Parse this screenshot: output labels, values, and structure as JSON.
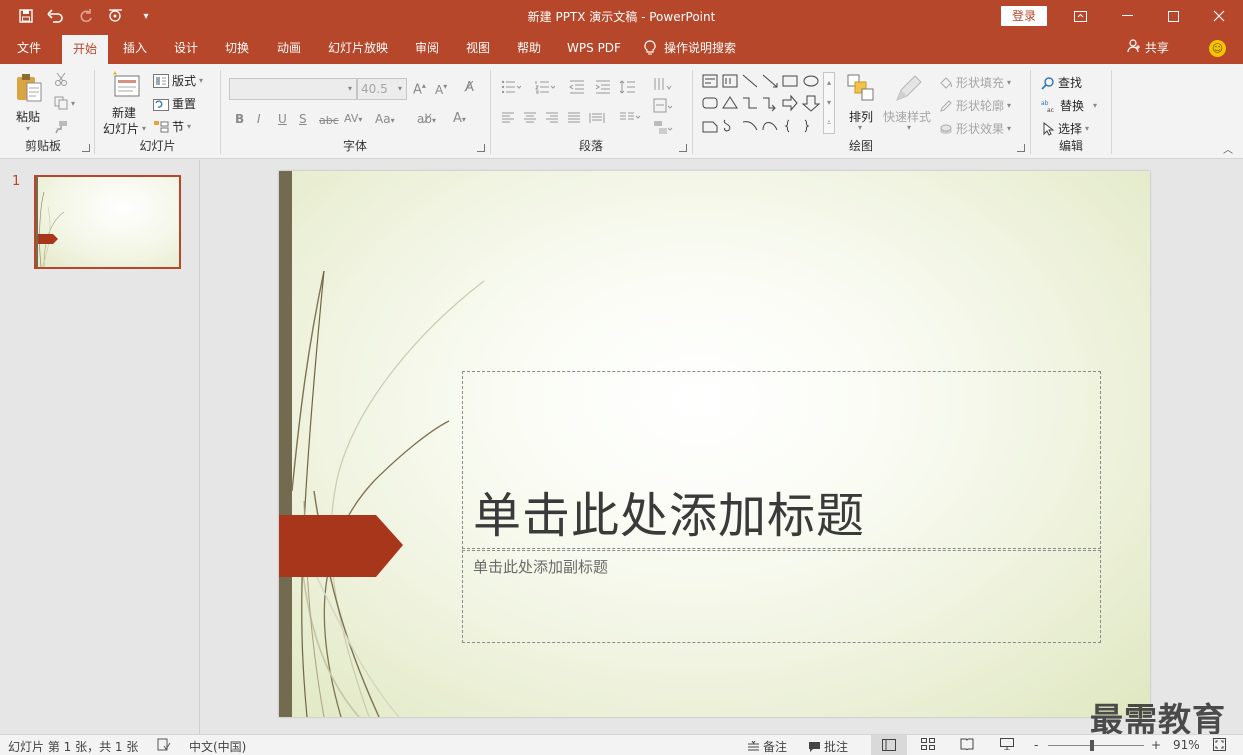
{
  "titlebar": {
    "title": "新建 PPTX 演示文稿  -  PowerPoint",
    "login": "登录",
    "qat": [
      "save-icon",
      "undo-icon",
      "redo-icon",
      "touch-mode-icon",
      "customize-qat-icon"
    ]
  },
  "menu": {
    "tabs": [
      "文件",
      "开始",
      "插入",
      "设计",
      "切换",
      "动画",
      "幻灯片放映",
      "审阅",
      "视图",
      "帮助",
      "WPS PDF"
    ],
    "active": "开始",
    "tell_me": "操作说明搜索",
    "share": "共享"
  },
  "ribbon": {
    "clipboard": {
      "paste": "粘贴",
      "label": "剪贴板"
    },
    "slides": {
      "new_slide_1": "新建",
      "new_slide_2": "幻灯片",
      "layout": "版式",
      "reset": "重置",
      "section": "节",
      "label": "幻灯片"
    },
    "font": {
      "font_name": "",
      "font_size": "40.5",
      "bold": "B",
      "italic": "I",
      "underline": "U",
      "strike": "S",
      "shadow": "abc",
      "char_spacing": "AV",
      "change_case": "Aa",
      "label": "字体"
    },
    "paragraph": {
      "label": "段落"
    },
    "drawing": {
      "arrange": "排列",
      "quick_styles": "快速样式",
      "shape_fill": "形状填充",
      "shape_outline": "形状轮廓",
      "shape_effects": "形状效果",
      "label": "绘图"
    },
    "editing": {
      "find": "查找",
      "replace": "替换",
      "select": "选择",
      "label": "编辑"
    }
  },
  "thumbnails": [
    {
      "number": "1"
    }
  ],
  "slide": {
    "title_placeholder": "单击此处添加标题",
    "subtitle_placeholder": "单击此处添加副标题"
  },
  "statusbar": {
    "slide_info": "幻灯片 第 1 张，共 1 张",
    "language": "中文(中国)",
    "notes": "备注",
    "comments": "批注",
    "zoom_minus": "-",
    "zoom_plus": "+",
    "zoom": "91%"
  },
  "watermark": "最需教育",
  "colors": {
    "accent": "#b7472a",
    "slide_bar": "#736b4f",
    "arrow": "#a8361b"
  }
}
